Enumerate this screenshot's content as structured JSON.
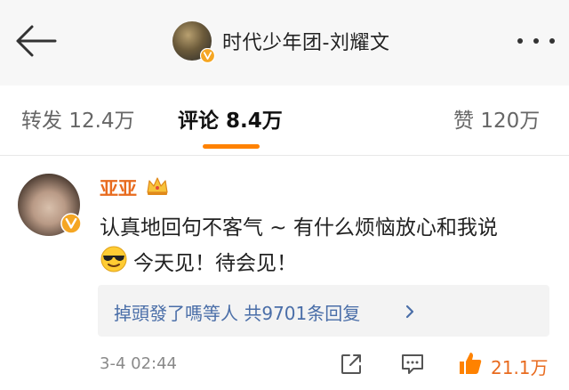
{
  "header": {
    "title": "时代少年团-刘耀文"
  },
  "tabs": {
    "repost": {
      "label": "转发",
      "count": "12.4万"
    },
    "comment": {
      "label": "评论",
      "count": "8.4万"
    },
    "like": {
      "label": "赞",
      "count": "120万"
    }
  },
  "comment": {
    "username": "亚亚",
    "text_line1": "认真地回句不客气 ~ 有什么烦恼放心和我说",
    "text_line2": "今天见！待会见！",
    "reply_summary": "掉頭發了嗎等人 共9701条回复",
    "timestamp": "3-4 02:44",
    "like_count": "21.1万"
  },
  "colors": {
    "accent": "#ff8200",
    "username": "#e86b1f",
    "link": "#4a6ea8",
    "verified_badge": "#f5a623"
  },
  "icons": [
    "back-arrow-icon",
    "more-icon",
    "verified-badge-icon",
    "crown-icon",
    "cool-emoji-icon",
    "chevron-right-icon",
    "share-icon",
    "comment-icon",
    "like-icon"
  ]
}
